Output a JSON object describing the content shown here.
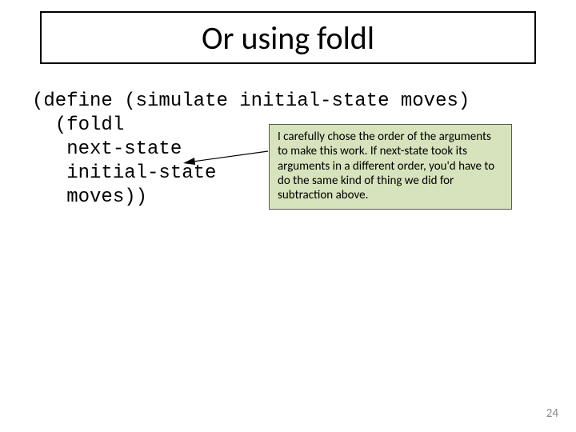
{
  "title": "Or using foldl",
  "code": "(define (simulate initial-state moves)\n  (foldl\n   next-state\n   initial-state\n   moves))",
  "callout_text": "I carefully chose the order of the arguments to make this work.  If next-state took its arguments in a different order, you'd have to do the same kind of thing we did for subtraction above.",
  "page_number": "24"
}
